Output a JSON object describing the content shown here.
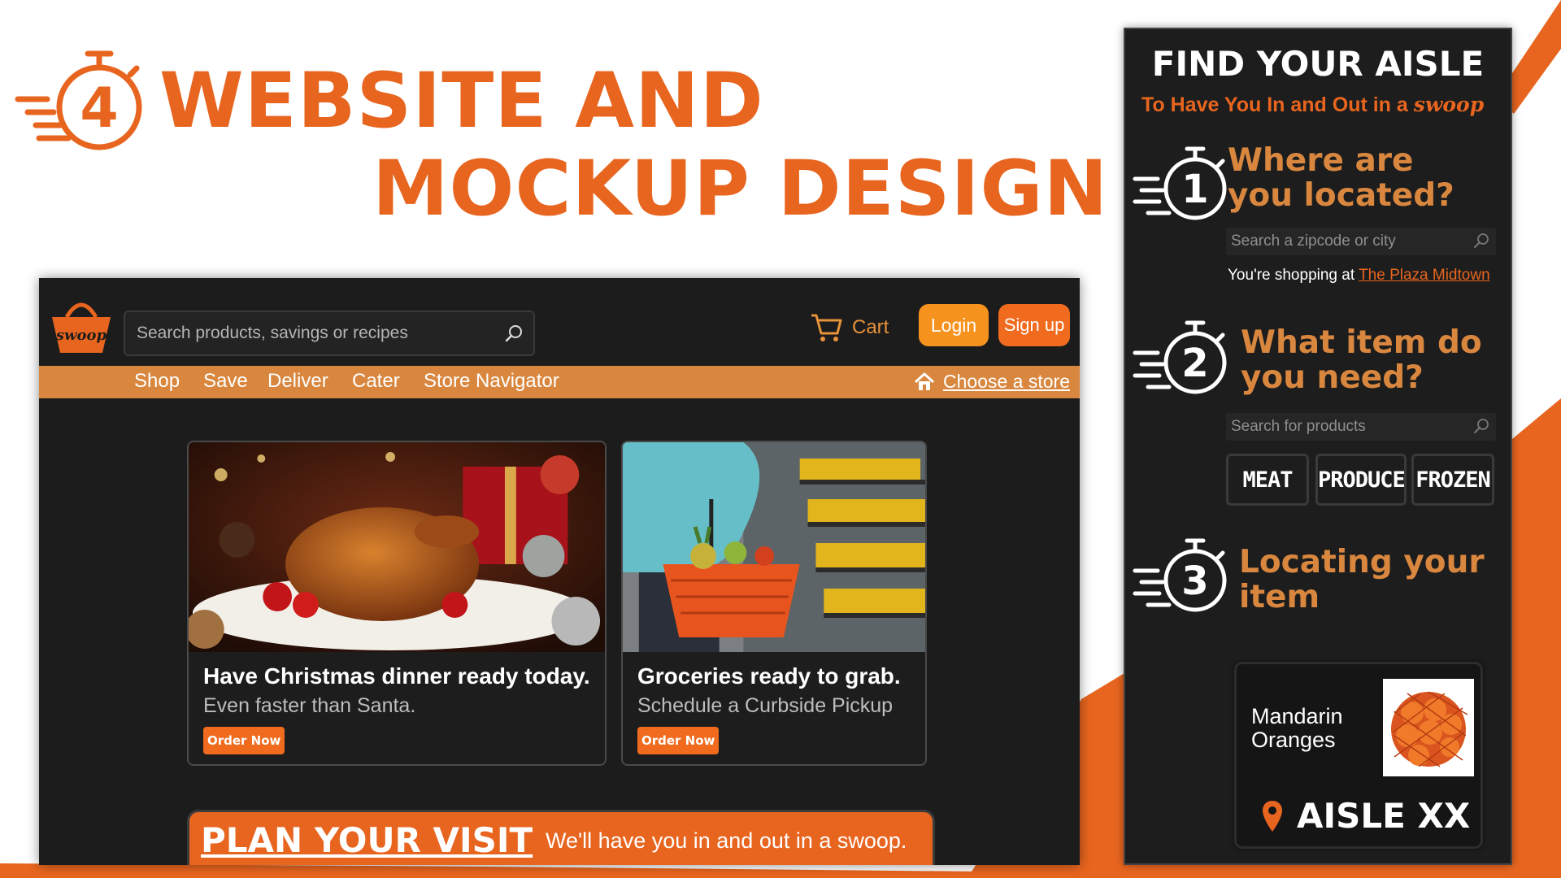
{
  "headline": {
    "number": "4",
    "line1": "WEBSITE AND",
    "line2": "MOCKUP DESIGN"
  },
  "colors": {
    "brand_orange": "#e8651f",
    "nav_orange": "#d9873f",
    "button_orange": "#f6921e",
    "dark_bg": "#1c1c1c"
  },
  "website": {
    "logo_text": "swoop",
    "search": {
      "placeholder": "Search products, savings or recipes",
      "icon": "search-icon"
    },
    "cart_label": "Cart",
    "login_label": "Login",
    "signup_label": "Sign up",
    "nav": [
      "Shop",
      "Save",
      "Deliver",
      "Cater",
      "Store Navigator"
    ],
    "choose_store": "Choose a store",
    "cards": [
      {
        "title": "Have Christmas dinner ready today.",
        "subtitle": "Even faster than Santa.",
        "button": "Order Now",
        "image": "christmas-roast-chicken"
      },
      {
        "title": "Groceries ready to grab.",
        "subtitle": "Schedule a Curbside Pickup",
        "button": "Order Now",
        "image": "shopper-with-basket"
      }
    ],
    "plan": {
      "title": "PLAN YOUR VISIT",
      "subtitle": "We'll have you in and out in a swoop."
    }
  },
  "kiosk": {
    "title": "FIND YOUR AISLE",
    "subtitle": "To Have You In and Out in a",
    "brand": "swoop",
    "steps": [
      {
        "number": "1",
        "question_line1": "Where are",
        "question_line2": "you located?"
      },
      {
        "number": "2",
        "question_line1": "What item do",
        "question_line2": "you need?"
      },
      {
        "number": "3",
        "question_line1": "Locating your",
        "question_line2": "item"
      }
    ],
    "location_search_placeholder": "Search a zipcode or city",
    "shopping_prefix": "You're shopping at",
    "shopping_store": "The Plaza Midtown",
    "product_search_placeholder": "Search for products",
    "categories": [
      "MEAT",
      "PRODUCE",
      "FROZEN"
    ],
    "result": {
      "name_line1": "Mandarin",
      "name_line2": "Oranges",
      "aisle": "AISLE XX"
    }
  }
}
